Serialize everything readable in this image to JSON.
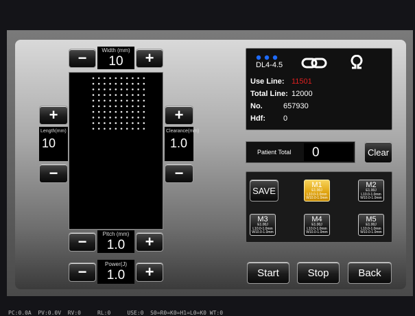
{
  "width": {
    "label": "Width",
    "unit": "(mm)",
    "value": "10"
  },
  "length": {
    "label": "Length",
    "unit": "(mm)",
    "value": "10"
  },
  "clearance": {
    "label": "Clearance",
    "unit": "(mm)",
    "value": "1.0"
  },
  "pitch": {
    "label": "Pitch",
    "unit": "(mm)",
    "value": "1.0"
  },
  "power": {
    "label": "Power",
    "unit": "(J)",
    "value": "1.0"
  },
  "controls": {
    "minus": "−",
    "plus": "+"
  },
  "cartridge": {
    "model": "DL4-4.5",
    "use_line_label": "Use Line:",
    "use_line_value": "11501",
    "total_line_label": "Total Line:",
    "total_line_value": "12000",
    "no_label": "No.",
    "no_value": "657930",
    "hdf_label": "Hdf:",
    "hdf_value": "0",
    "link_icon": "chain-link-icon",
    "device_icon": "omega-icon"
  },
  "patient": {
    "label": "Patient Total",
    "value": "0",
    "clear_label": "Clear"
  },
  "memory": {
    "save_label": "SAVE",
    "slots": [
      {
        "name": "M1",
        "line1": "E1.00J",
        "line2": "L10.0-1.0mm",
        "line3": "W10.0-1.0mm",
        "active": true
      },
      {
        "name": "M2",
        "line1": "E1.00J",
        "line2": "L10.0-1.0mm",
        "line3": "W10.0-1.0mm",
        "active": false
      },
      {
        "name": "M3",
        "line1": "E1.00J",
        "line2": "L10.0-1.0mm",
        "line3": "W10.0-1.0mm",
        "active": false
      },
      {
        "name": "M4",
        "line1": "E1.00J",
        "line2": "L10.0-1.0mm",
        "line3": "W10.0-1.0mm",
        "active": false
      },
      {
        "name": "M5",
        "line1": "E1.00J",
        "line2": "L10.0-1.0mm",
        "line3": "W10.0-1.0mm",
        "active": false
      }
    ]
  },
  "actions": {
    "start": "Start",
    "stop": "Stop",
    "back": "Back"
  },
  "status_bar": "PC:0.0A  PV:0.0V  RV:0     RL:0     USE:0  S0=R0=K0=H1=L0=K0 WT:0",
  "colors": {
    "accent_gold": "#e0a410",
    "use_line_red": "#e02020",
    "indicator_blue": "#1e6bff"
  }
}
